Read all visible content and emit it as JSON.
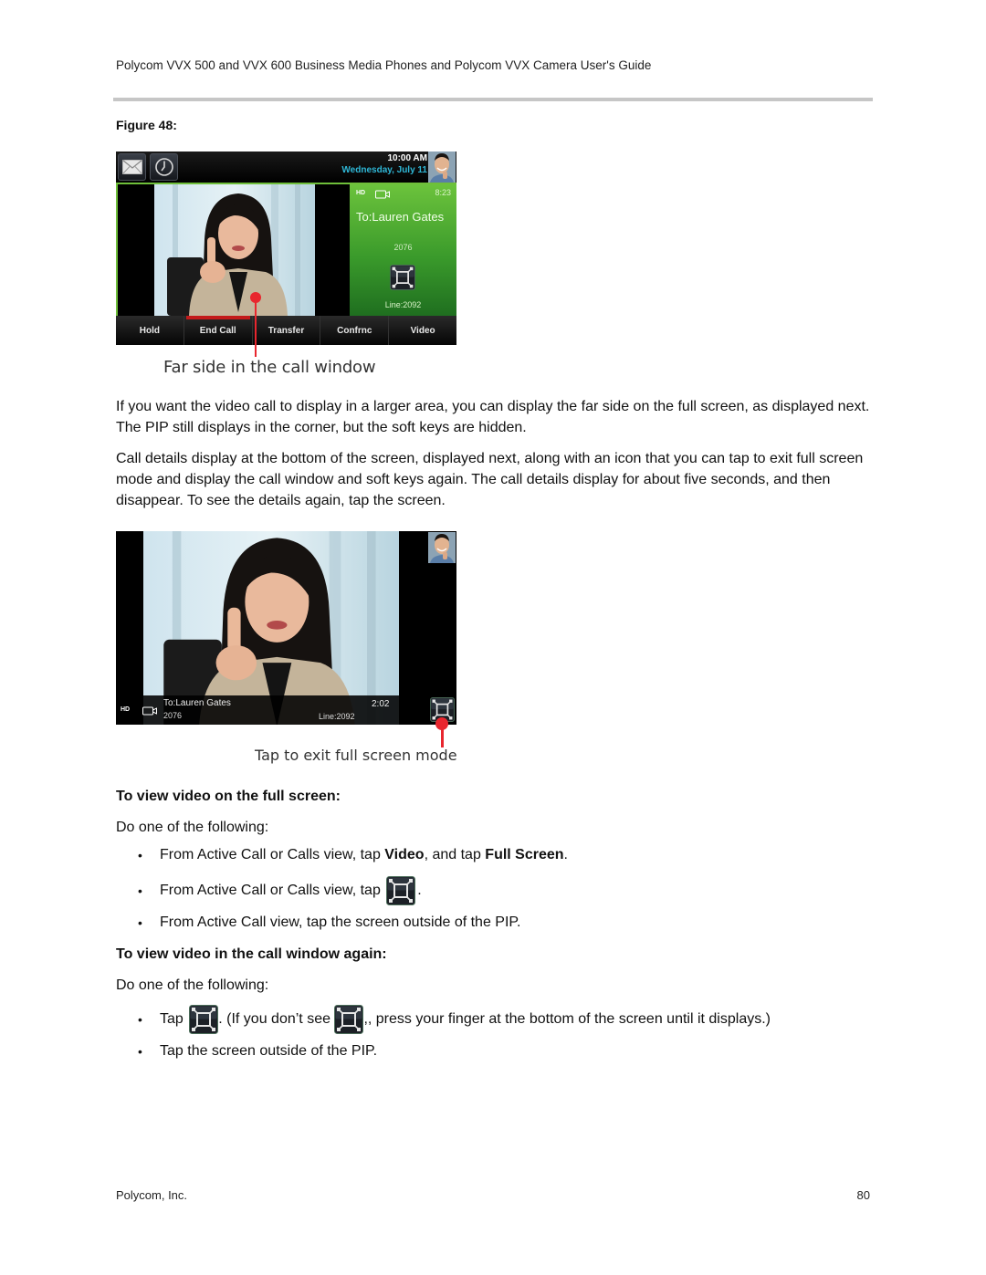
{
  "header": {
    "title": "Polycom VVX 500 and VVX 600 Business Media Phones and Polycom VVX Camera User's Guide"
  },
  "figure": {
    "label": "Figure 48:"
  },
  "screenshot1": {
    "status_bar": {
      "time": "10:00 AM",
      "date": "Wednesday, July 11",
      "icons": [
        "mail-icon",
        "clock-icon"
      ]
    },
    "call_panel": {
      "hd_badge": "HD",
      "timer": "8:23",
      "to": "To:Lauren Gates",
      "number": "2076",
      "line": "Line:2092"
    },
    "softkeys": [
      "Hold",
      "End Call",
      "Transfer",
      "Confrnc",
      "Video"
    ],
    "callout": "Far side in the call window",
    "colors": {
      "panel_green": "#4aab32",
      "date_blue": "#2fb7d6",
      "end_call_red": "#c31a1a",
      "callout_red": "#e8262e"
    }
  },
  "paragraphs": [
    "If you want the video call to display in a larger area, you can display the far side on the full screen, as displayed next. The PIP still displays in the corner, but the soft keys are hidden.",
    "Call details display at the bottom of the screen, displayed next, along with an icon that you can tap to exit full screen mode and display the call window and soft keys again. The call details display for about five seconds, and then disappear. To see the details again, tap the screen."
  ],
  "screenshot2": {
    "bar": {
      "hd_badge": "HD",
      "to": "To:Lauren Gates",
      "number": "2076",
      "line": "Line:2092",
      "timer": "2:02"
    },
    "callout": "Tap to exit full screen mode"
  },
  "procedure1": {
    "heading": "To view video on the full screen:",
    "intro": "Do one of the following:",
    "bullets": [
      {
        "pre": "From Active Call or Calls view, tap ",
        "b1": "Video",
        "mid": ", and tap ",
        "b2": "Full Screen",
        "post": "."
      },
      {
        "pre": "From Active Call or Calls view, tap ",
        "post": "."
      },
      {
        "text": "From Active Call view, tap the screen outside of the PIP."
      }
    ]
  },
  "procedure2": {
    "heading": "To view video in the call window again:",
    "intro": "Do one of the following:",
    "bullets": [
      {
        "pre": "Tap ",
        "mid": ". (If you don’t see ",
        "post": ",, press your finger at the bottom of the screen until it displays.)"
      },
      {
        "text": "Tap the screen outside of the PIP."
      }
    ]
  },
  "bullet_char": "•",
  "footer": {
    "company": "Polycom, Inc.",
    "page": "80"
  }
}
